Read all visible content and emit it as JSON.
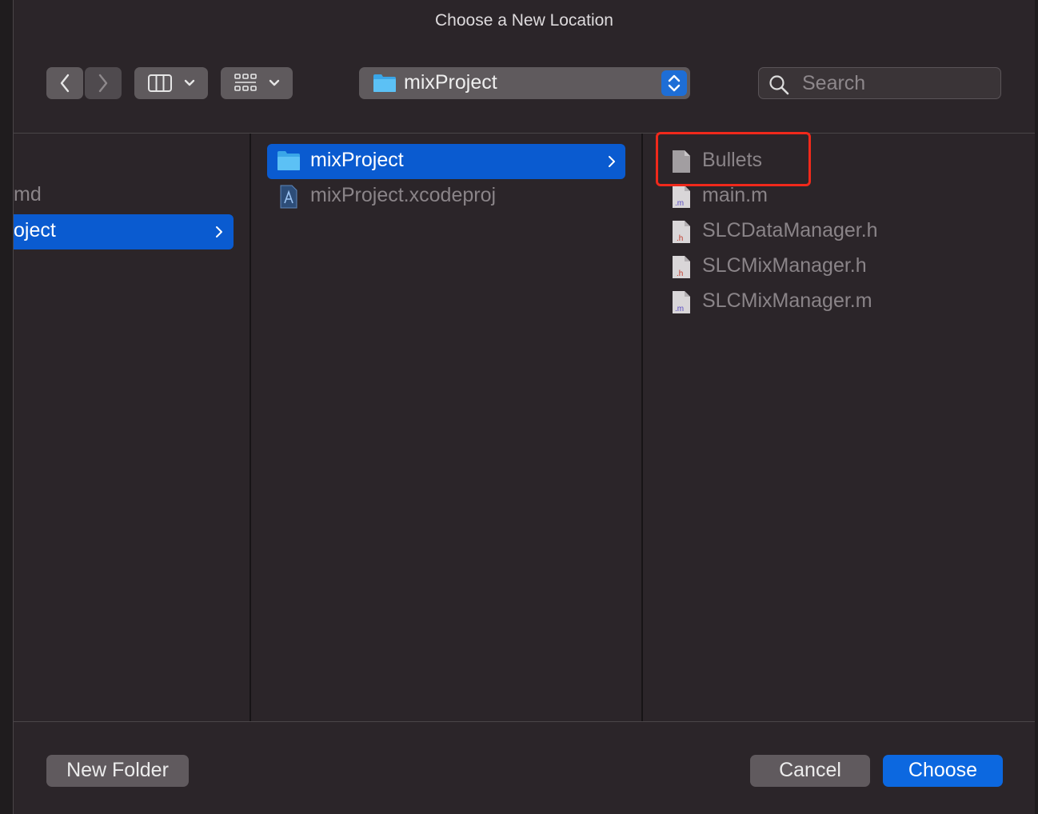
{
  "window": {
    "title": "Choose a New Location"
  },
  "toolbar": {
    "path_popup_label": "mixProject",
    "search_placeholder": "Search"
  },
  "columns": {
    "col1": {
      "items": [
        {
          "label": "md"
        },
        {
          "label": "oject"
        }
      ]
    },
    "col2": {
      "items": [
        {
          "label": "mixProject"
        },
        {
          "label": "mixProject.xcodeproj"
        }
      ]
    },
    "col3": {
      "items": [
        {
          "label": "Bullets"
        },
        {
          "label": "main.m",
          "badge": ".m"
        },
        {
          "label": "SLCDataManager.h",
          "badge": ".h"
        },
        {
          "label": "SLCMixManager.h",
          "badge": ".h"
        },
        {
          "label": "SLCMixManager.m",
          "badge": ".m"
        }
      ]
    }
  },
  "footer": {
    "new_folder_label": "New Folder",
    "cancel_label": "Cancel",
    "choose_label": "Choose"
  },
  "colors": {
    "selection": "#0a5bd0",
    "accent": "#0c68e0",
    "highlight_box": "#f0291b",
    "window_bg": "#2b2529"
  }
}
